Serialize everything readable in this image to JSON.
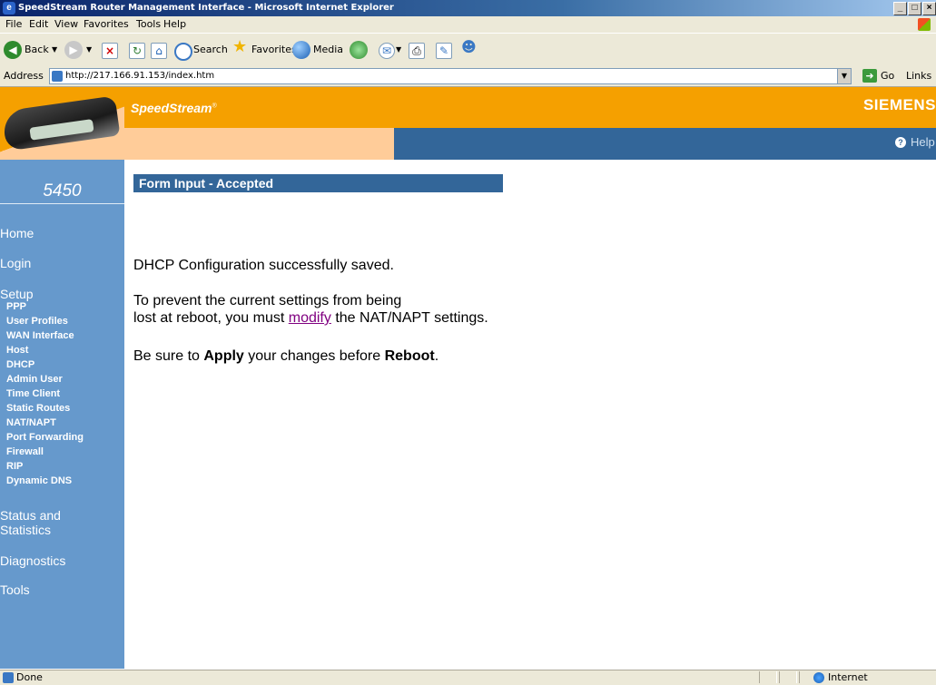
{
  "window": {
    "title": "SpeedStream Router Management Interface - Microsoft Internet Explorer",
    "controls": [
      "_",
      "□",
      "×"
    ]
  },
  "menu": [
    "File",
    "Edit",
    "View",
    "Favorites",
    "Tools",
    "Help"
  ],
  "toolbar": {
    "back": "Back",
    "search": "Search",
    "favorites": "Favorites",
    "media": "Media"
  },
  "address": {
    "label": "Address",
    "url": "http://217.166.91.153/index.htm",
    "go": "Go",
    "links": "Links"
  },
  "header": {
    "brand": "SpeedStream",
    "brand_mark": "®",
    "vendor": "SIEMENS",
    "help": "Help"
  },
  "sidebar": {
    "model": "5450",
    "home": "Home",
    "login": "Login",
    "setup": "Setup",
    "setup_items": [
      "PPP",
      "User Profiles",
      "WAN Interface",
      "Host",
      "DHCP",
      "Admin User",
      "Time Client",
      "Static Routes",
      "NAT/NAPT",
      "Port Forwarding",
      "Firewall",
      "RIP",
      "Dynamic DNS"
    ],
    "status_line1": "Status and",
    "status_line2": "Statistics",
    "diagnostics": "Diagnostics",
    "tools": "Tools"
  },
  "main": {
    "section_title": "Form Input - Accepted",
    "saved_msg": "DHCP Configuration successfully saved.",
    "warn_line1": "To prevent the current settings from being",
    "warn_pre": "lost at reboot, you must ",
    "warn_link": "modify",
    "warn_post": " the NAT/NAPT settings.",
    "apply_pre": "Be sure to ",
    "apply_word": "Apply",
    "apply_mid": " your changes before ",
    "reboot_word": "Reboot",
    "apply_post": "."
  },
  "status": {
    "text": "Done",
    "zone": "Internet"
  }
}
